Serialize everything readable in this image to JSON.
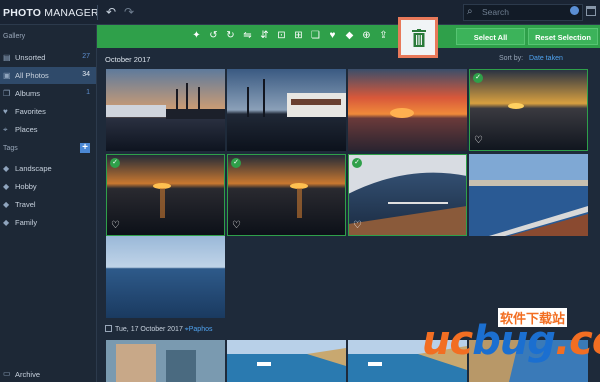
{
  "app": {
    "title_bold": "PHOTO",
    "title_rest": " MANAGER"
  },
  "topbar": {
    "search_placeholder": "Search"
  },
  "sidebar": {
    "gallery_heading": "Gallery",
    "items": [
      {
        "label": "Unsorted",
        "count": "27",
        "icon": "inbox-icon"
      },
      {
        "label": "All Photos",
        "count": "34",
        "icon": "photos-icon"
      },
      {
        "label": "Albums",
        "count": "1",
        "icon": "albums-icon"
      },
      {
        "label": "Favorites",
        "count": "",
        "icon": "heart-icon"
      },
      {
        "label": "Places",
        "count": "",
        "icon": "pin-icon"
      }
    ],
    "tags_heading": "Tags",
    "tags": [
      {
        "label": "Landscape",
        "icon": "tag-icon"
      },
      {
        "label": "Hobby",
        "icon": "tag-icon"
      },
      {
        "label": "Travel",
        "icon": "tag-icon"
      },
      {
        "label": "Family",
        "icon": "tag-icon"
      }
    ],
    "archive": "Archive"
  },
  "toolbar": {
    "select_all": "Select All",
    "reset_selection": "Reset Selection",
    "accent": "#2fa04a",
    "highlight": "#e8795a"
  },
  "main": {
    "date_heading": "October 2017",
    "sort_label": "Sort by:",
    "sort_value": "Date taken",
    "date2": "Tue, 17 October 2017",
    "location": "Paphos"
  },
  "photos": [
    {
      "scene": "harbor-sunset",
      "selected": false,
      "favorite": false
    },
    {
      "scene": "boat-dock",
      "selected": false,
      "favorite": false
    },
    {
      "scene": "red-sunset",
      "selected": false,
      "favorite": false
    },
    {
      "scene": "sunset-sea",
      "selected": true,
      "favorite": true
    },
    {
      "scene": "sunset-sea",
      "selected": true,
      "favorite": true
    },
    {
      "scene": "sunset-sea",
      "selected": true,
      "favorite": true
    },
    {
      "scene": "sail-boat",
      "selected": true,
      "favorite": true
    },
    {
      "scene": "blue-coast",
      "selected": false,
      "favorite": false
    },
    {
      "scene": "blue-sea",
      "selected": false,
      "favorite": false
    },
    {
      "scene": "beach-umbrella",
      "selected": false,
      "favorite": false
    },
    {
      "scene": "bay-boats",
      "selected": false,
      "favorite": false
    },
    {
      "scene": "bay-boats",
      "selected": false,
      "favorite": false
    },
    {
      "scene": "cliff-sea",
      "selected": false,
      "favorite": false
    }
  ],
  "watermark": {
    "text_a": "uc",
    "text_b": "bug",
    "text_c": ".cc",
    "cn": "软件下载站"
  }
}
